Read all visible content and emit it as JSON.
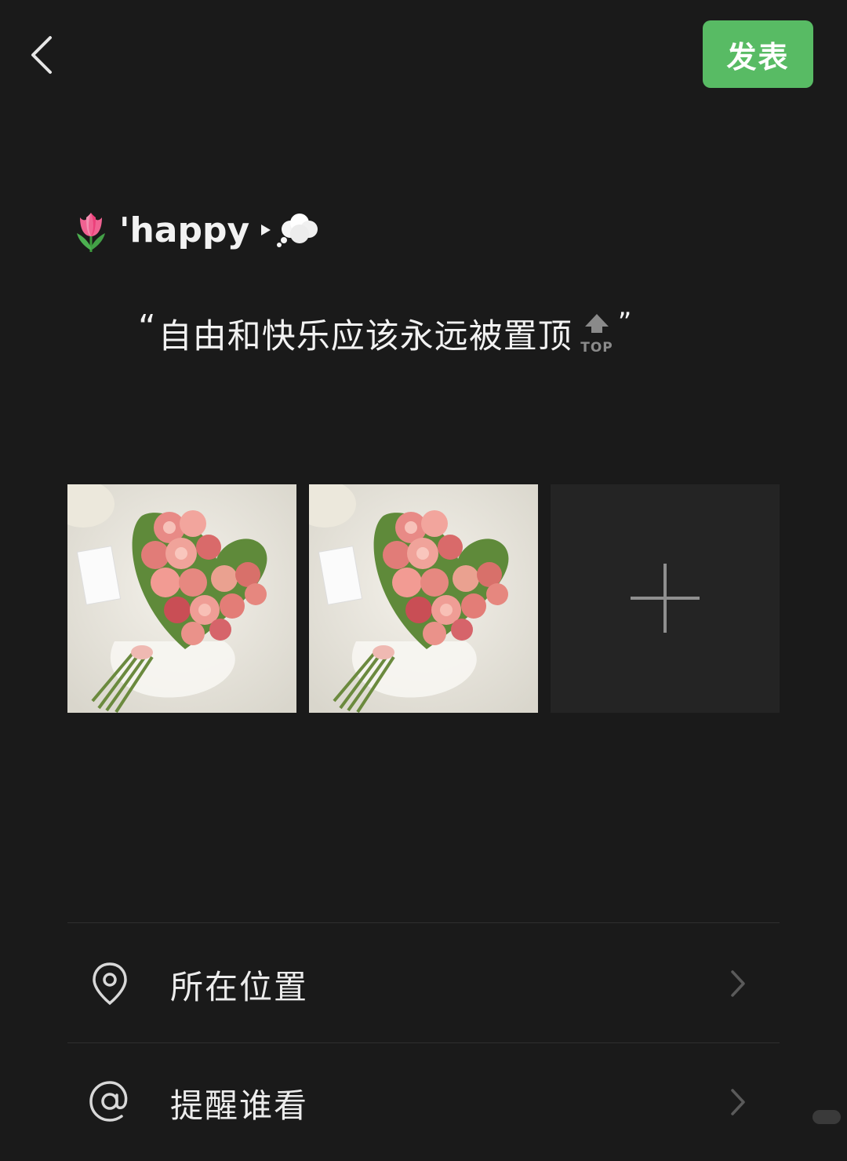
{
  "header": {
    "back_icon": "chevron-left-icon",
    "publish_label": "发表",
    "publish_color": "#58bb64"
  },
  "post": {
    "line1_prefix_emoji": "tulip-emoji",
    "line1_text": "'happy",
    "line1_suffix_emoji": "thought-balloon-emoji",
    "quote_open": "“",
    "quote_text": "自由和快乐应该永远被置顶",
    "top_icon_label": "TOP",
    "quote_close": "”"
  },
  "images": [
    {
      "alt": "heart-shaped pink rose bouquet photo 1"
    },
    {
      "alt": "heart-shaped pink rose bouquet photo 2"
    }
  ],
  "add_photo_icon": "plus-icon",
  "options": [
    {
      "icon": "location-pin-icon",
      "label": "所在位置"
    },
    {
      "icon": "at-sign-icon",
      "label": "提醒谁看"
    }
  ],
  "colors": {
    "background": "#1a1a1a",
    "add_tile": "#242424",
    "divider": "#2f2f2f"
  }
}
